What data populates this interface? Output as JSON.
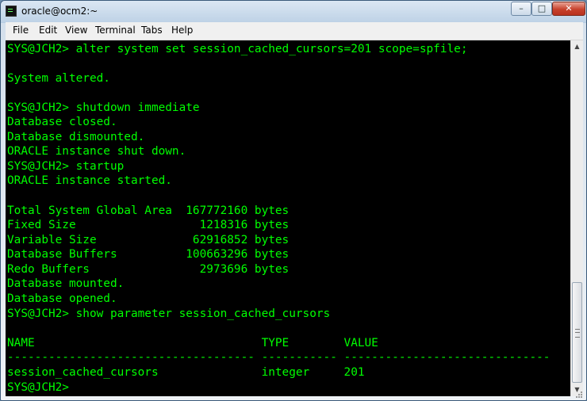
{
  "window": {
    "title": "oracle@ocm2:~",
    "controls": {
      "minimize": "–",
      "maximize": "□",
      "close": "✕"
    }
  },
  "menu": [
    "File",
    "Edit",
    "View",
    "Terminal",
    "Tabs",
    "Help"
  ],
  "terminal": {
    "text_color": "#00ff00",
    "background": "#000000",
    "lines": [
      "SYS@JCH2> alter system set session_cached_cursors=201 scope=spfile;",
      "",
      "System altered.",
      "",
      "SYS@JCH2> shutdown immediate",
      "Database closed.",
      "Database dismounted.",
      "ORACLE instance shut down.",
      "SYS@JCH2> startup",
      "ORACLE instance started.",
      "",
      "Total System Global Area  167772160 bytes",
      "Fixed Size                  1218316 bytes",
      "Variable Size              62916852 bytes",
      "Database Buffers          100663296 bytes",
      "Redo Buffers                2973696 bytes",
      "Database mounted.",
      "Database opened.",
      "SYS@JCH2> show parameter session_cached_cursors",
      "",
      "NAME                                 TYPE        VALUE",
      "------------------------------------ ----------- ------------------------------",
      "session_cached_cursors               integer     201",
      "SYS@JCH2> "
    ]
  },
  "scrollbar": {
    "up_arrow": "▲",
    "down_arrow": "▼"
  }
}
